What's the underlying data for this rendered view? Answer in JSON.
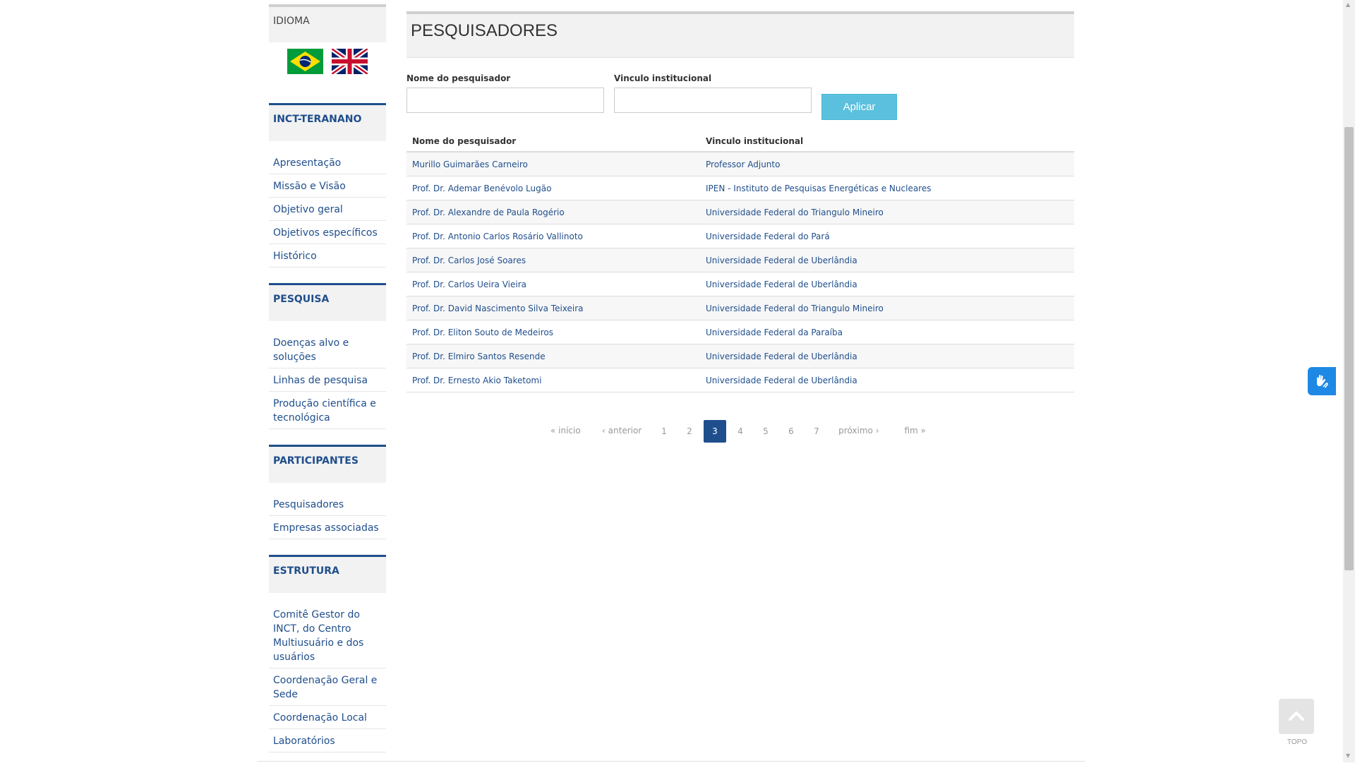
{
  "sidebar": {
    "language_heading": "IDIOMA",
    "flags": [
      {
        "icon": "brazil-flag-icon",
        "colors": {
          "green": "#009b3a",
          "yellow": "#fedf00",
          "blue": "#002776"
        }
      },
      {
        "icon": "uk-flag-icon",
        "colors": {
          "blue": "#012169",
          "red": "#c8102e",
          "white": "#ffffff"
        }
      }
    ],
    "sections": [
      {
        "heading": "INCT-TERANANO",
        "items": [
          "Apresentação",
          "Missão e Visão",
          "Objetivo geral",
          "Objetivos específicos",
          "Histórico"
        ]
      },
      {
        "heading": "PESQUISA",
        "items": [
          "Doenças alvo e soluções",
          "Linhas de pesquisa",
          "Produção científica e tecnológica"
        ]
      },
      {
        "heading": "PARTICIPANTES",
        "items": [
          "Pesquisadores",
          "Empresas associadas"
        ]
      },
      {
        "heading": "ESTRUTURA",
        "items": [
          "Comitê Gestor do INCT, do Centro Multiusuário e dos usuários",
          "Coordenação Geral e Sede",
          "Coordenação Local",
          "Laboratórios"
        ]
      }
    ]
  },
  "main": {
    "title": "PESQUISADORES",
    "filters": {
      "name_label": "Nome do pesquisador",
      "name_value": "",
      "institution_label": "Vinculo institucional",
      "institution_value": "",
      "apply_label": "Aplicar"
    },
    "table": {
      "columns": [
        "Nome do pesquisador",
        "Vinculo institucional"
      ],
      "rows": [
        [
          "Murillo Guimarães Carneiro",
          "Professor Adjunto"
        ],
        [
          "Prof. Dr. Ademar Benévolo Lugão",
          "IPEN - Instituto de Pesquisas Energéticas e Nucleares"
        ],
        [
          "Prof. Dr. Alexandre de Paula Rogério",
          "Universidade Federal do Triangulo Mineiro"
        ],
        [
          "Prof. Dr. Antonio Carlos Rosário Vallinoto",
          "Universidade Federal do Pará"
        ],
        [
          "Prof. Dr. Carlos José Soares",
          "Universidade Federal de Uberlândia"
        ],
        [
          "Prof. Dr. Carlos Ueira Vieira",
          "Universidade Federal de Uberlândia"
        ],
        [
          "Prof. Dr. David Nascimento Silva Teixeira",
          "Universidade Federal do Triangulo Mineiro"
        ],
        [
          "Prof. Dr. Eliton Souto de Medeiros",
          "Universidade Federal da Paraíba"
        ],
        [
          "Prof. Dr. Elmiro Santos Resende",
          "Universidade Federal de Uberlândia"
        ],
        [
          "Prof. Dr. Ernesto Akio Taketomi",
          "Universidade Federal de Uberlândia"
        ]
      ]
    },
    "pager": {
      "first": "« início",
      "prev": "‹ anterior",
      "pages": [
        "1",
        "2",
        "3",
        "4",
        "5",
        "6",
        "7"
      ],
      "current": "3",
      "next": "próximo ›",
      "last": "fim »"
    }
  },
  "widgets": {
    "accessibility_icon": "sign-language-hands-icon",
    "back_to_top_icon": "chevron-up-icon",
    "back_to_top_label": "TOPO"
  },
  "colors": {
    "link": "#1f4e8c",
    "section_border": "#1f4e8c",
    "button": "#5bc0de",
    "pager_active": "#1f4e8c",
    "vlibras": "#1e88e5"
  }
}
